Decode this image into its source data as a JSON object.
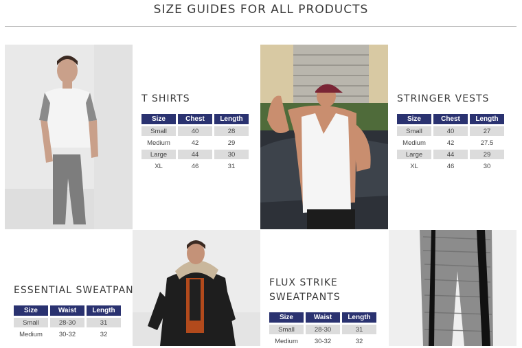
{
  "page": {
    "title": "SIZE GUIDES FOR ALL PRODUCTS"
  },
  "guides": [
    {
      "title": "T SHIRTS",
      "headers": [
        "Size",
        "Chest",
        "Length"
      ],
      "rows": [
        [
          "Small",
          "40",
          "28"
        ],
        [
          "Medium",
          "42",
          "29"
        ],
        [
          "Large",
          "44",
          "30"
        ],
        [
          "XL",
          "46",
          "31"
        ]
      ]
    },
    {
      "title": "STRINGER VESTS",
      "headers": [
        "Size",
        "Chest",
        "Length"
      ],
      "rows": [
        [
          "Small",
          "40",
          "27"
        ],
        [
          "Medium",
          "42",
          "27.5"
        ],
        [
          "Large",
          "44",
          "29"
        ],
        [
          "XL",
          "46",
          "30"
        ]
      ]
    },
    {
      "title": "ESSENTIAL SWEATPANTS",
      "headers": [
        "Size",
        "Waist",
        "Length"
      ],
      "rows": [
        [
          "Small",
          "28-30",
          "31"
        ],
        [
          "Medium",
          "30-32",
          "32"
        ]
      ]
    },
    {
      "title": "FLUX STRIKE SWEATPANTS",
      "title_line1": "FLUX STRIKE",
      "title_line2": "SWEATPANTS",
      "headers": [
        "Size",
        "Waist",
        "Length"
      ],
      "rows": [
        [
          "Small",
          "28-30",
          "31"
        ],
        [
          "Medium",
          "30-32",
          "32"
        ]
      ]
    }
  ],
  "colors": {
    "header_bg": "#2a3270",
    "row_shade": "#dcdcdc",
    "rule": "#bdbdbd"
  },
  "images": {
    "tshirt": "man in white t-shirt and grey joggers",
    "vest": "muscular man in white stringer vest and red cap",
    "jacket": "man in black puffer jacket with fur hood",
    "flux": "grey marl sweatpants with black side stripe"
  }
}
